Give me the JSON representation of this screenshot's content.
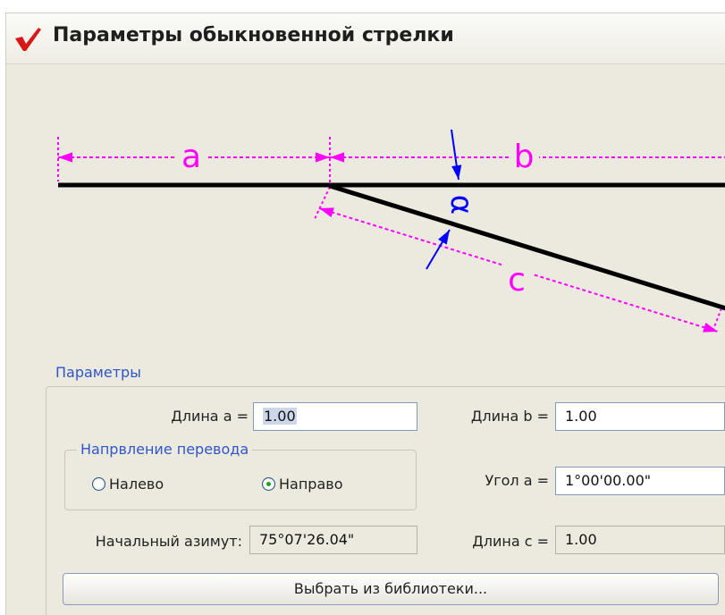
{
  "window": {
    "title": "Параметры обыкновенной стрелки",
    "icon": "red-checkmark-icon"
  },
  "diagram": {
    "label_a": "a",
    "label_b": "b",
    "label_c": "c",
    "label_angle": "α",
    "dimension_color": "#ff00ff",
    "angle_arrow_color": "#0000ff",
    "line_color": "#000000"
  },
  "params": {
    "legend": "Параметры",
    "length_a_label": "Длина a =",
    "length_a_value": "1.00",
    "length_b_label": "Длина b =",
    "length_b_value": "1.00",
    "direction": {
      "legend": "Напрвление перевода",
      "left_label": "Налево",
      "right_label": "Направо",
      "selected": "Направо"
    },
    "angle_label": "Угол a =",
    "angle_value": "1°00'00.00\"",
    "azimuth_label": "Начальный азимут:",
    "azimuth_value": "75°07'26.04\"",
    "length_c_label": "Длина c =",
    "length_c_value": "1.00"
  },
  "library_button_label": "Выбрать из библиотеки...",
  "colors": {
    "legend_text": "#2f55c9",
    "window_bg": "#eceadf",
    "checkmark": "#d81818"
  }
}
